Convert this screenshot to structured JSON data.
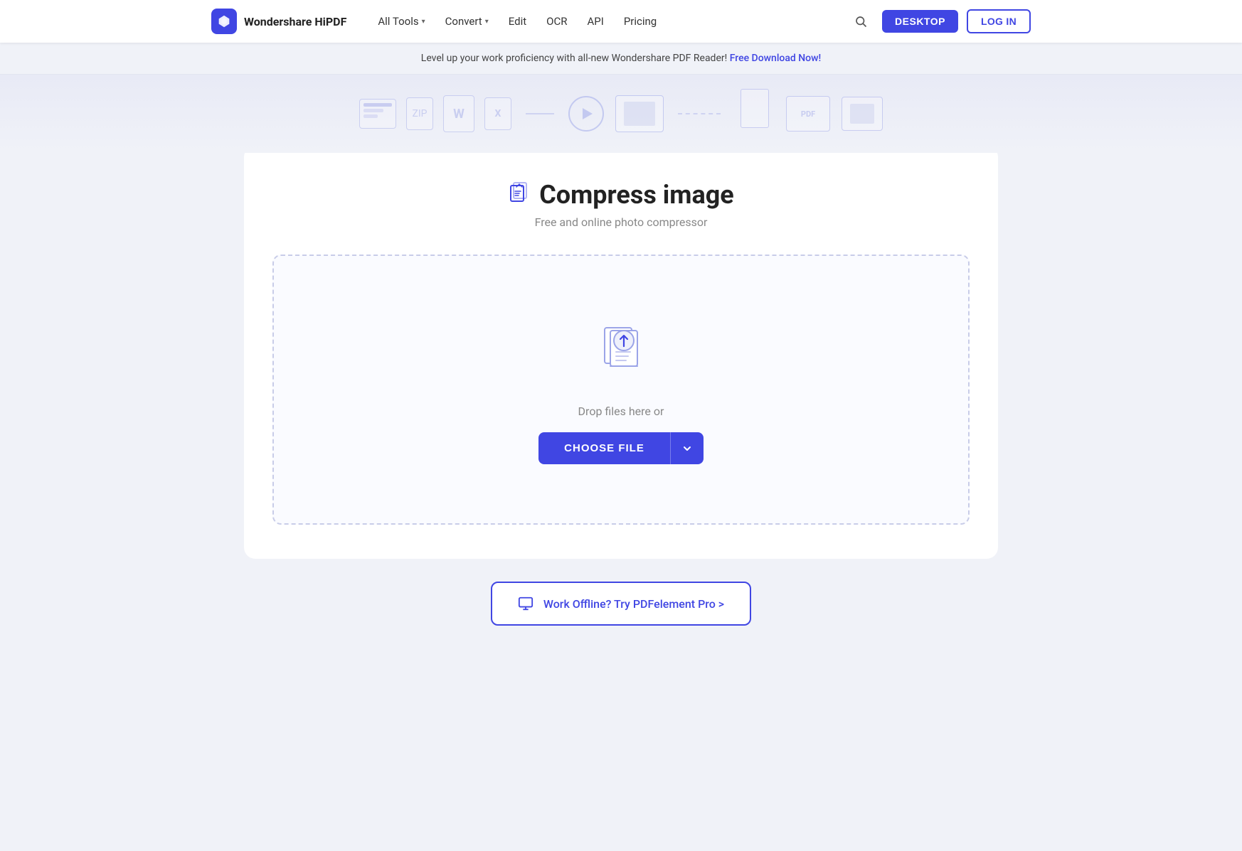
{
  "brand": {
    "name": "Wondershare HiPDF"
  },
  "nav": {
    "items": [
      {
        "label": "All Tools",
        "hasDropdown": true
      },
      {
        "label": "Convert",
        "hasDropdown": true
      },
      {
        "label": "Edit",
        "hasDropdown": false
      },
      {
        "label": "OCR",
        "hasDropdown": false
      },
      {
        "label": "API",
        "hasDropdown": false
      },
      {
        "label": "Pricing",
        "hasDropdown": false
      }
    ],
    "desktop_btn": "DESKTOP",
    "login_btn": "LOG IN"
  },
  "banner": {
    "text": "Level up your work proficiency with all-new Wondershare PDF Reader!",
    "link_text": "Free Download Now!"
  },
  "tool": {
    "title": "Compress image",
    "subtitle": "Free and online photo compressor",
    "drop_text": "Drop files here or",
    "choose_file_label": "CHOOSE FILE"
  },
  "offline": {
    "label": "Work Offline? Try PDFelement Pro >"
  }
}
